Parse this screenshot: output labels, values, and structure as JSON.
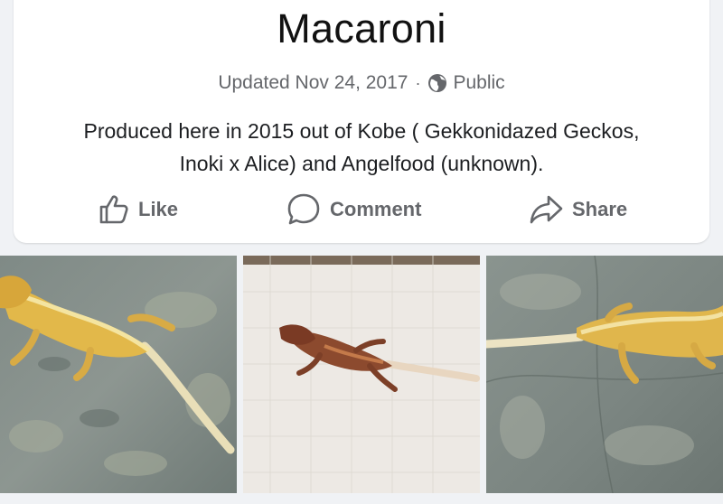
{
  "post": {
    "title": "Macaroni",
    "updated": "Updated Nov 24, 2017",
    "separator": "·",
    "privacy": "Public",
    "description": "Produced here in 2015 out of Kobe ( Gekkonidazed Geckos, Inoki x Alice) and Angelfood (unknown)."
  },
  "actions": {
    "like": "Like",
    "comment": "Comment",
    "share": "Share"
  },
  "icons": {
    "privacy": "globe-icon",
    "like": "thumbs-up-icon",
    "comment": "comment-bubble-icon",
    "share": "share-arrow-icon"
  },
  "colors": {
    "muted_text": "#65676b",
    "card_bg": "#ffffff",
    "page_bg": "#f0f2f5"
  }
}
